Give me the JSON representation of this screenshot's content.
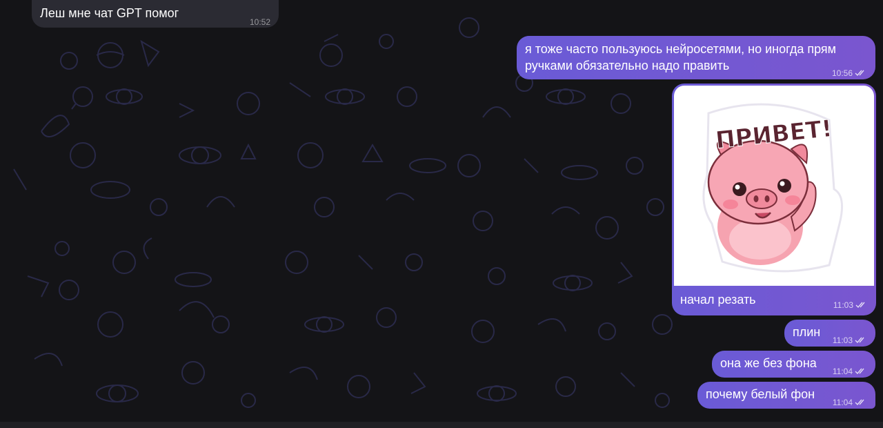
{
  "messages": [
    {
      "id": "m1",
      "direction": "incoming",
      "text": "Леш мне чат GPT помог",
      "time": "10:52"
    },
    {
      "id": "m2",
      "direction": "outgoing",
      "text_line1": "я тоже часто пользуюсь нейросетями, но иногда прям",
      "text_line2": "ручками обязательно надо править",
      "time": "10:56",
      "read": true
    },
    {
      "id": "m3",
      "direction": "outgoing",
      "sticker": {
        "title": "ПРИВЕТ!"
      },
      "text": "начал резать",
      "time": "11:03",
      "read": true
    },
    {
      "id": "m4",
      "direction": "outgoing",
      "text": "плин",
      "time": "11:03",
      "read": true
    },
    {
      "id": "m5",
      "direction": "outgoing",
      "text": "она же без фона",
      "time": "11:04",
      "read": true
    },
    {
      "id": "m6",
      "direction": "outgoing",
      "text": "почему белый фон",
      "time": "11:04",
      "read": true
    }
  ],
  "icons": {
    "read_receipt": "double-check-icon"
  },
  "colors": {
    "background": "#141417",
    "incoming_bubble": "#2b2b33",
    "outgoing_bubble_start": "#6a5bd6",
    "outgoing_bubble_end": "#7a56cf",
    "pattern": "#2a2a4a"
  }
}
